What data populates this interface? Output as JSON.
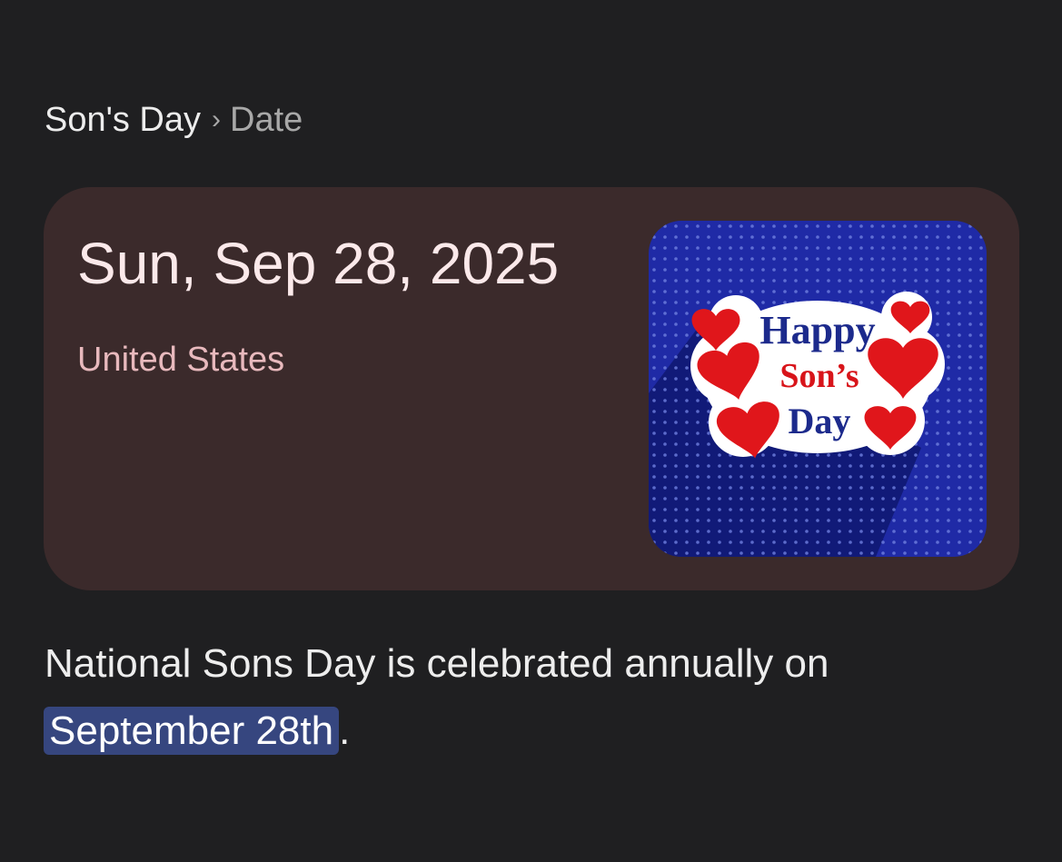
{
  "breadcrumb": {
    "parent": "Son's Day",
    "separator": "›",
    "current": "Date"
  },
  "card": {
    "date": "Sun, Sep 28, 2025",
    "country": "United States",
    "image": {
      "line1": "Happy",
      "line2": "Son’s",
      "line3": "Day"
    }
  },
  "description": {
    "text_before": "National Sons Day is celebrated annually on ",
    "highlight": "September 28th",
    "text_after": "."
  }
}
